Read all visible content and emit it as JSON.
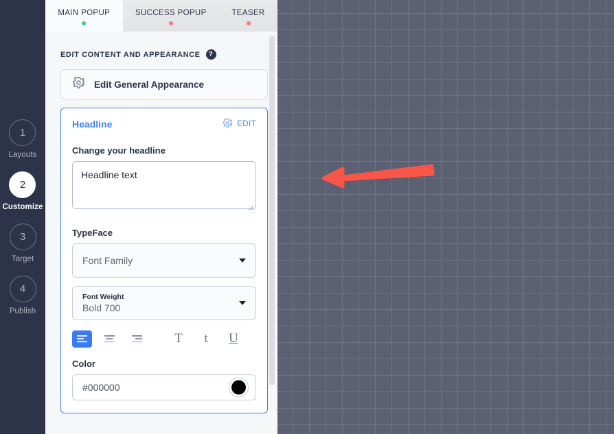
{
  "steps": [
    {
      "number": "1",
      "label": "Layouts",
      "active": false
    },
    {
      "number": "2",
      "label": "Customize",
      "active": true
    },
    {
      "number": "3",
      "label": "Target",
      "active": false
    },
    {
      "number": "4",
      "label": "Publish",
      "active": false
    }
  ],
  "tabs": [
    {
      "label": "MAIN POPUP",
      "status": "green",
      "active": true
    },
    {
      "label": "SUCCESS POPUP",
      "status": "red",
      "active": false
    },
    {
      "label": "TEASER",
      "status": "red",
      "active": false
    }
  ],
  "panel": {
    "section_title": "EDIT CONTENT AND APPEARANCE",
    "help_icon_glyph": "?",
    "general_appearance": {
      "icon": "gear-icon",
      "label": "Edit General Appearance"
    },
    "headline_card": {
      "title": "Headline",
      "edit_label": "EDIT",
      "edit_icon": "gear-icon",
      "field_label": "Change your headline",
      "textarea_value": "Headline text",
      "typeface_label": "TypeFace",
      "font_family": {
        "mini_label": "",
        "value": "Font Family"
      },
      "font_weight": {
        "mini_label": "Font Weight",
        "value": "Bold 700"
      },
      "format_buttons": [
        {
          "name": "align-left-icon",
          "active": true
        },
        {
          "name": "align-center-icon",
          "active": false
        },
        {
          "name": "align-right-icon",
          "active": false
        }
      ],
      "case_buttons": [
        {
          "name": "uppercase-icon",
          "glyph": "T"
        },
        {
          "name": "lowercase-icon",
          "glyph": "t"
        },
        {
          "name": "underline-icon",
          "glyph": "U"
        }
      ],
      "color_label": "Color",
      "color_value": "#000000",
      "color_swatch": "#000000"
    }
  },
  "preview": {
    "annotation_arrow_color": "#f9564a"
  },
  "colors": {
    "sidebar_bg": "#2d3349",
    "accent_blue": "#3b7bf0",
    "link_blue": "#4285f4",
    "tab_active_bg": "#fafbfc",
    "status_green": "#3ecf7a",
    "status_red": "#f97a72",
    "canvas_bg": "#5b6072"
  }
}
